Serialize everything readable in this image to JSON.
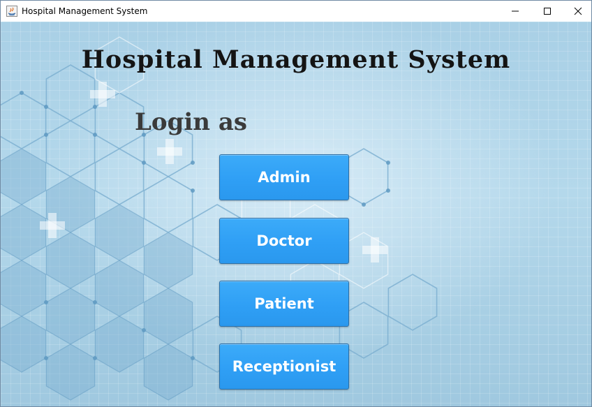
{
  "window": {
    "title": "Hospital Management System",
    "controls": [
      "minimize",
      "maximize",
      "close"
    ]
  },
  "header": {
    "title": "Hospital Management System",
    "subtitle": "Login as"
  },
  "login_options": [
    {
      "label": "Admin"
    },
    {
      "label": "Doctor"
    },
    {
      "label": "Patient"
    },
    {
      "label": "Receptionist"
    }
  ],
  "colors": {
    "button": "#2f9ff5",
    "button_border": "#2d6fa6",
    "background": "#b4d8eb",
    "title_text": "#141414"
  }
}
